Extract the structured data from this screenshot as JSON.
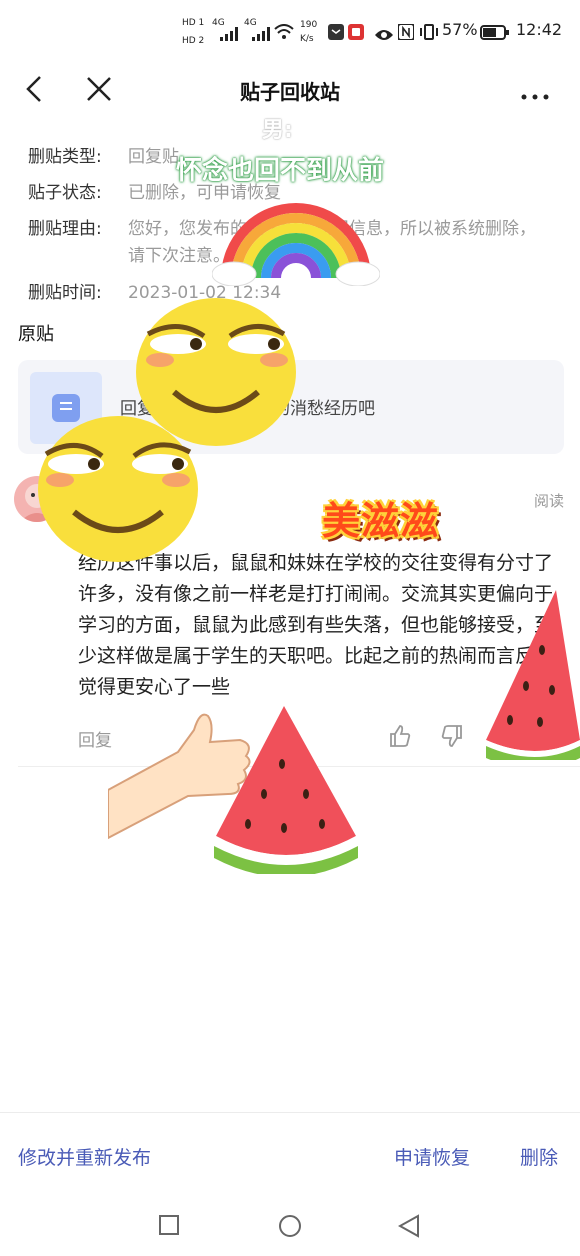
{
  "status_bar": {
    "hd1": "HD 1",
    "hd2": "HD 2",
    "net1": "4G",
    "net2": "4G",
    "speed_value": "190",
    "speed_unit": "K/s",
    "battery": "57%",
    "time": "12:42"
  },
  "header": {
    "title": "贴子回收站"
  },
  "info": {
    "type_label": "删贴类型:",
    "type_value": "回复贴",
    "status_label": "贴子状态:",
    "status_value": "已删除，可申请恢复",
    "reason_label": "删贴理由:",
    "reason_value": "您好，您发布的贴子包含违规信息，所以被系统删除，请下次注意。",
    "time_label": "删贴时间:",
    "time_value": "2023-01-02 12:34"
  },
  "original": {
    "section_title": "原贴",
    "card_text": "回复：也聊一聊自己的消愁经历吧"
  },
  "post": {
    "read_label": "阅读",
    "body": "经历这件事以后，鼠鼠和妹妹在学校的交往变得有分寸了许多，没有像之前一样老是打打闹闹。交流其实更偏向于学习的方面，鼠鼠为此感到有些失落，但也能够接受，至少这样做是属于学生的天职吧。比起之前的热闹而言反而觉得更安心了一些",
    "reply_label": "回复"
  },
  "stickers": {
    "top_small": "男:",
    "caption": "怀念也回不到从前",
    "badge": "美滋滋"
  },
  "bottom_bar": {
    "edit_repost": "修改并重新发布",
    "apply_restore": "申请恢复",
    "delete": "删除"
  },
  "colors": {
    "accent": "#4a5bb7",
    "muted": "#9a9a9a"
  }
}
